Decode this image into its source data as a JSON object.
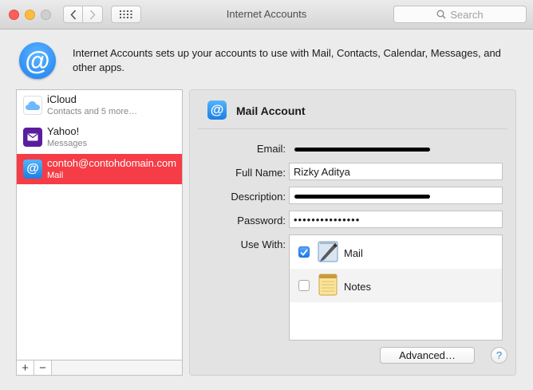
{
  "window": {
    "title": "Internet Accounts",
    "search_placeholder": "Search"
  },
  "header": {
    "description": "Internet Accounts sets up your accounts to use with Mail, Contacts, Calendar, Messages, and other apps."
  },
  "accounts": [
    {
      "name": "iCloud",
      "subtitle": "Contacts and 5 more…",
      "icon": "icloud-icon",
      "selected": false
    },
    {
      "name": "Yahoo!",
      "subtitle": "Messages",
      "icon": "yahoo-icon",
      "selected": false
    },
    {
      "name": "contoh@contohdomain.com",
      "subtitle": "Mail",
      "icon": "at-sign-icon",
      "selected": true
    }
  ],
  "list_controls": {
    "add": "+",
    "remove": "−"
  },
  "detail": {
    "title": "Mail Account",
    "labels": {
      "email": "Email:",
      "full_name": "Full Name:",
      "description": "Description:",
      "password": "Password:",
      "use_with": "Use With:"
    },
    "values": {
      "full_name": "Rizky Aditya",
      "password": "•••••••••••••••"
    },
    "use_with": [
      {
        "label": "Mail",
        "checked": true,
        "icon": "mail-app-icon"
      },
      {
        "label": "Notes",
        "checked": false,
        "icon": "notes-app-icon"
      }
    ],
    "advanced_label": "Advanced…",
    "help_label": "?"
  },
  "colors": {
    "selection": "#f63c46",
    "accent": "#1e7ff0"
  }
}
